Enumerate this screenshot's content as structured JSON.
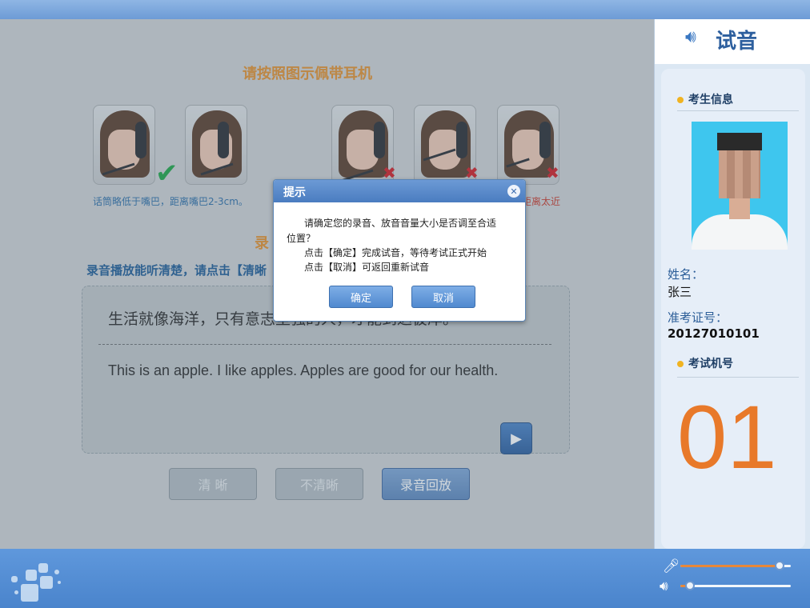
{
  "main": {
    "title": "请按照图示佩带耳机",
    "captions": {
      "correct": "话筒略低于嘴巴，距离嘴巴2-3cm。",
      "too_close": "距离太近"
    },
    "subtitle": "录",
    "instruction": "录音播放能听清楚，请点击【清晰",
    "sample_text_cn": "生活就像海洋，只有意志坚强的人，才能到达彼岸。",
    "sample_text_en": "This is an apple. I like apples. Apples are good for our health.",
    "buttons": {
      "clear": "清 晰",
      "not_clear": "不清晰",
      "playback": "录音回放"
    }
  },
  "sidebar": {
    "title": "试音",
    "candidate_info": "考生信息",
    "name_label": "姓名：",
    "name_value": "张三",
    "ticket_label": "准考证号：",
    "ticket_value": "20127010101",
    "seat_label": "考试机号",
    "seat_value": "01"
  },
  "dialog": {
    "title": "提示",
    "line1": "请确定您的录音、放音音量大小是否调至合适",
    "line2": "位置？",
    "line3": "点击【确定】完成试音，等待考试正式开始",
    "line4": "点击【取消】可返回重新试音",
    "ok": "确定",
    "cancel": "取消"
  },
  "controls": {
    "mic_level": 0.9,
    "speaker_level": 0.09
  },
  "colors": {
    "accent_orange": "#e8792a",
    "title_blue": "#2d5f9e",
    "correct_green": "#1fa646",
    "wrong_red": "#d21e24"
  }
}
